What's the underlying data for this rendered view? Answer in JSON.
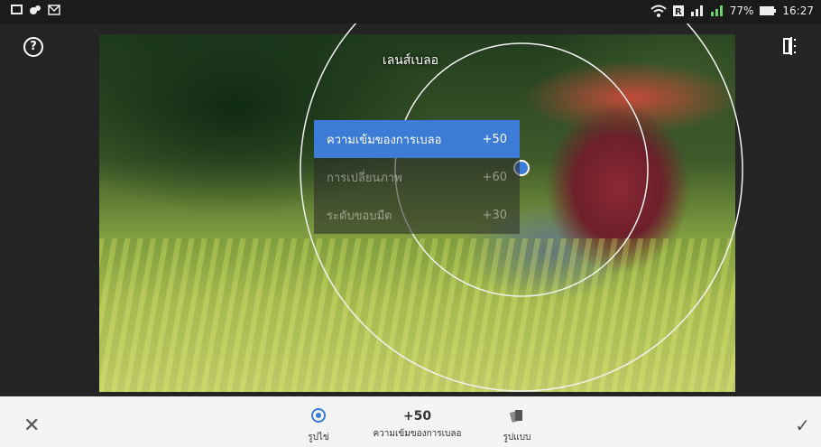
{
  "status": {
    "battery_percent": "77%",
    "time": "16:27"
  },
  "editor": {
    "tool_title": "เลนส์เบลอ",
    "menu": [
      {
        "label": "ความเข้มของการเบลอ",
        "value": "+50",
        "active": true
      },
      {
        "label": "การเปลี่ยนภาพ",
        "value": "+60",
        "active": false
      },
      {
        "label": "ระดับขอบมืด",
        "value": "+30",
        "active": false
      }
    ]
  },
  "bottom": {
    "shape_tab": "รูปไข่",
    "value": "+50",
    "value_label": "ความเข้มของการเบลอ",
    "style_tab": "รูปแบบ"
  },
  "colors": {
    "accent": "#3c7bd6",
    "toolbar": "#f4f4f4"
  }
}
